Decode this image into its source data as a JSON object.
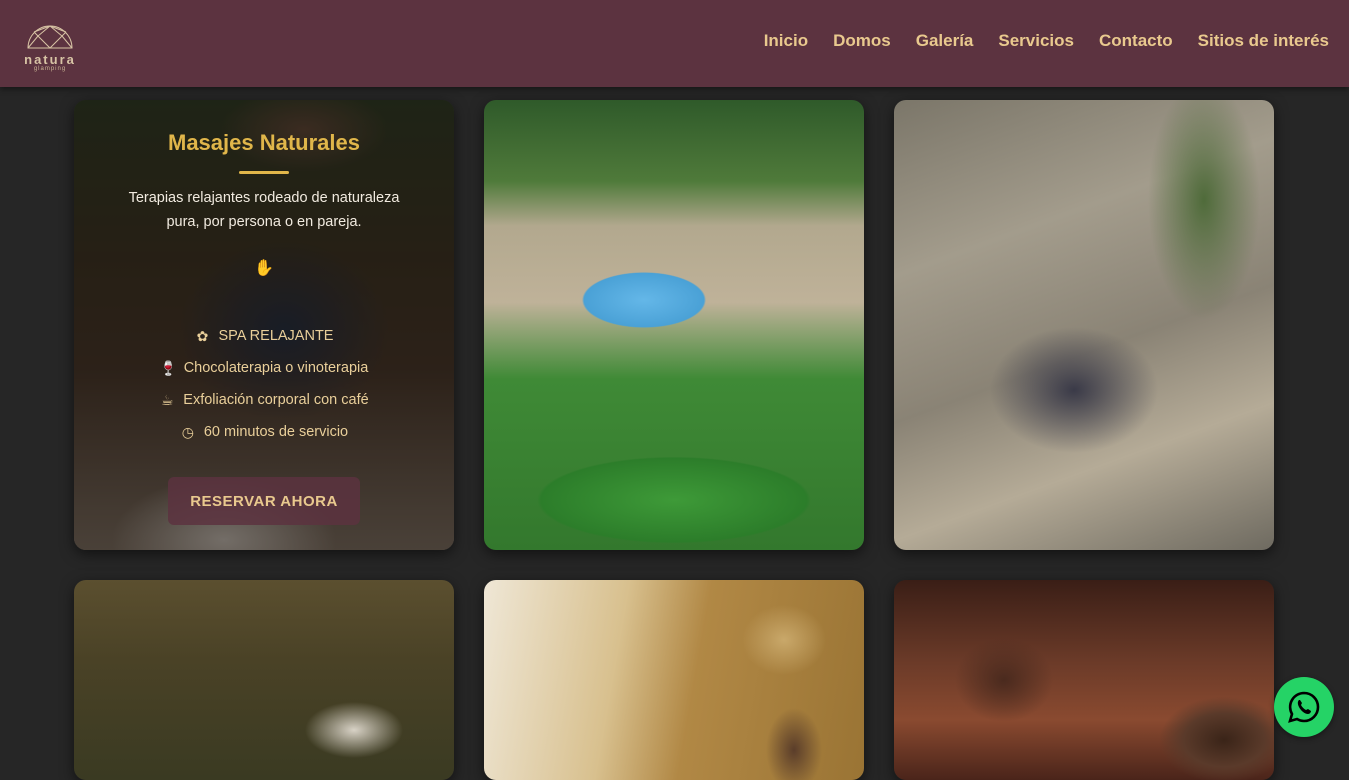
{
  "header": {
    "logo": {
      "name": "natura",
      "sub": "glamping"
    },
    "nav": [
      "Inicio",
      "Domos",
      "Galería",
      "Servicios",
      "Contacto",
      "Sitios de interés"
    ]
  },
  "service": {
    "title": "Masajes Naturales",
    "description": "Terapias relajantes rodeado de naturaleza pura, por persona o en pareja.",
    "icon": "massage-hand-icon",
    "features": [
      {
        "icon": "lotus-icon",
        "text": "SPA RELAJANTE"
      },
      {
        "icon": "wine-glass-icon",
        "text": "Chocolaterapia o vinoterapia"
      },
      {
        "icon": "coffee-cup-icon",
        "text": "Exfoliación corporal con café"
      },
      {
        "icon": "clock-icon",
        "text": "60 minutos de servicio"
      }
    ],
    "button": "RESERVAR AHORA"
  },
  "gallery": [
    {
      "name": "yoga-pool-photo"
    },
    {
      "name": "rappel-climbing-photo"
    },
    {
      "name": "dome-forest-photo"
    },
    {
      "name": "dome-interior-photo"
    },
    {
      "name": "coffee-cup-photo"
    }
  ],
  "whatsapp": {
    "icon": "whatsapp-icon"
  },
  "colors": {
    "header_bg": "#5c3340",
    "nav_text": "#e9c98e",
    "accent_gold": "#e0b64a",
    "page_bg": "#262626",
    "whatsapp": "#25d366"
  }
}
